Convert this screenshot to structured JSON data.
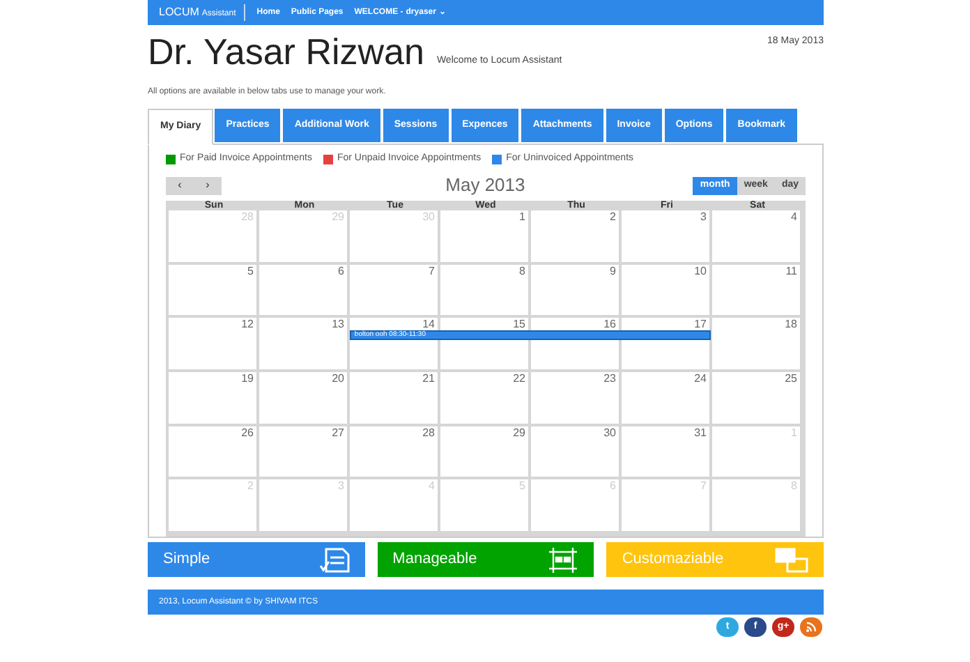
{
  "nav": {
    "brand": "LOCUM",
    "brand_sub": "Assistant",
    "links": [
      "Home",
      "Public Pages"
    ],
    "welcome": "WELCOME -",
    "user": "dryaser",
    "caret": "⌄"
  },
  "header": {
    "name": "Dr. Yasar Rizwan",
    "welcome": "Welcome to Locum Assistant",
    "date": "18 May 2013"
  },
  "intro": "All options are available in below tabs use to manage your work.",
  "tabs": [
    {
      "label": "My Diary",
      "selected": true
    },
    {
      "label": "Practices",
      "selected": false
    },
    {
      "label": "Additional Work",
      "selected": false
    },
    {
      "label": "Sessions",
      "selected": false
    },
    {
      "label": "Expences",
      "selected": false
    },
    {
      "label": "Attachments",
      "selected": false
    },
    {
      "label": "Invoice",
      "selected": false
    },
    {
      "label": "Options",
      "selected": false
    },
    {
      "label": "Bookmark",
      "selected": false
    }
  ],
  "legend": [
    {
      "label": "For Paid Invoice Appointments",
      "color": "#009900"
    },
    {
      "label": "For Unpaid Invoice Appointments",
      "color": "#e84040"
    },
    {
      "label": "For Uninvoiced Appointments",
      "color": "#2e88e8"
    }
  ],
  "calendar": {
    "prev": "‹",
    "next": "›",
    "title": "May 2013",
    "views": [
      {
        "label": "month",
        "selected": true
      },
      {
        "label": "week",
        "selected": false
      },
      {
        "label": "day",
        "selected": false
      }
    ],
    "weekdays": [
      "Sun",
      "Mon",
      "Tue",
      "Wed",
      "Thu",
      "Fri",
      "Sat"
    ],
    "weeks": [
      {
        "days": [
          {
            "day": "28",
            "in_month": false
          },
          {
            "day": "29",
            "in_month": false
          },
          {
            "day": "30",
            "in_month": false
          },
          {
            "day": "1",
            "in_month": true
          },
          {
            "day": "2",
            "in_month": true
          },
          {
            "day": "3",
            "in_month": true
          },
          {
            "day": "4",
            "in_month": true
          }
        ]
      },
      {
        "days": [
          {
            "day": "5",
            "in_month": true
          },
          {
            "day": "6",
            "in_month": true
          },
          {
            "day": "7",
            "in_month": true
          },
          {
            "day": "8",
            "in_month": true
          },
          {
            "day": "9",
            "in_month": true
          },
          {
            "day": "10",
            "in_month": true
          },
          {
            "day": "11",
            "in_month": true
          }
        ]
      },
      {
        "days": [
          {
            "day": "12",
            "in_month": true
          },
          {
            "day": "13",
            "in_month": true
          },
          {
            "day": "14",
            "in_month": true,
            "event": "bolton ooh 08:30-11:30"
          },
          {
            "day": "15",
            "in_month": true,
            "event_continues": true
          },
          {
            "day": "16",
            "in_month": true,
            "event_continues": true
          },
          {
            "day": "17",
            "in_month": true,
            "event_continues": true
          },
          {
            "day": "18",
            "in_month": true
          }
        ]
      },
      {
        "days": [
          {
            "day": "19",
            "in_month": true
          },
          {
            "day": "20",
            "in_month": true
          },
          {
            "day": "21",
            "in_month": true
          },
          {
            "day": "22",
            "in_month": true
          },
          {
            "day": "23",
            "in_month": true
          },
          {
            "day": "24",
            "in_month": true
          },
          {
            "day": "25",
            "in_month": true
          }
        ]
      },
      {
        "days": [
          {
            "day": "26",
            "in_month": true
          },
          {
            "day": "27",
            "in_month": true
          },
          {
            "day": "28",
            "in_month": true
          },
          {
            "day": "29",
            "in_month": true
          },
          {
            "day": "30",
            "in_month": true
          },
          {
            "day": "31",
            "in_month": true
          },
          {
            "day": "1",
            "in_month": false
          }
        ]
      },
      {
        "days": [
          {
            "day": "2",
            "in_month": false
          },
          {
            "day": "3",
            "in_month": false
          },
          {
            "day": "4",
            "in_month": false
          },
          {
            "day": "5",
            "in_month": false
          },
          {
            "day": "6",
            "in_month": false
          },
          {
            "day": "7",
            "in_month": false
          },
          {
            "day": "8",
            "in_month": false
          }
        ]
      }
    ]
  },
  "features": [
    {
      "label": "Simple",
      "kind": "form",
      "color": "#2e88e8"
    },
    {
      "label": "Manageable",
      "kind": "grid",
      "color": "#00a300"
    },
    {
      "label": "Customaziable",
      "kind": "images",
      "color": "#ffc40d"
    }
  ],
  "footer": "2013, Locum Assistant © by SHIVAM ITCS",
  "social": [
    {
      "kind": "twitter",
      "glyph": "t",
      "color": "#2fa8e0"
    },
    {
      "kind": "facebook",
      "glyph": "f",
      "color": "#2b4a8b"
    },
    {
      "kind": "googleplus",
      "glyph": "g+",
      "color": "#c1271b"
    },
    {
      "kind": "rss",
      "color": "#e8731c"
    }
  ]
}
